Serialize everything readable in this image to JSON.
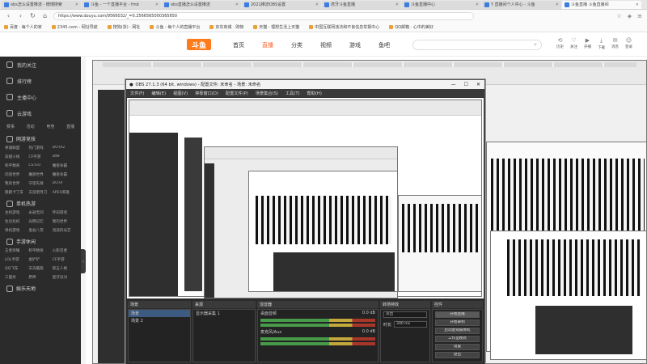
{
  "tabs": [
    {
      "label": "obs怎么设置推流 - 微博搜索",
      "active": false
    },
    {
      "label": "斗鱼 - 一个直播平台 - fmb",
      "active": false
    },
    {
      "label": "obs直播怎么设置推流",
      "active": false
    },
    {
      "label": "2021推流OBS设置",
      "active": false
    },
    {
      "label": "虎牙斗鱼直播",
      "active": false
    },
    {
      "label": "斗鱼直播中心",
      "active": false
    },
    {
      "label": "Y 直播间个人中心 - 斗鱼",
      "active": false
    },
    {
      "label": "斗鱼直播 斗鱼直播间",
      "active": true
    }
  ],
  "url": "https://www.douyu.com/9566032/_=0.2566565000365650",
  "bookmarks": [
    "百度 · 每个人的家",
    "2345.com - 网址导航",
    "搜狗(浙) · 网址",
    "斗鱼 - 每个人的直播平台",
    "京东商城 · 购物",
    "天猫 - 理想生活上天猫",
    "中国互联网违法和不良信息举报中心",
    "QQ邮箱 · 心中的美好"
  ],
  "header": {
    "logo": "斗鱼",
    "nav": [
      "首页",
      "直播",
      "分类",
      "视频",
      "游戏",
      "鱼吧"
    ],
    "active_nav": "直播",
    "search_icon": "search-icon",
    "user_tools": [
      "历史",
      "关注",
      "开播",
      "下载",
      "消息",
      "登录"
    ]
  },
  "sidebar": {
    "top": [
      "我的关注",
      "排行榜",
      "主播中心",
      "云游戏"
    ],
    "icons_row": [
      "赛事",
      "活动",
      "电竞",
      "直播"
    ],
    "sections": [
      {
        "title": "网游竞技",
        "items": [
          "英雄联盟",
          "热门游戏",
          "DOTA2",
          "穿越火线",
          "CF手游",
          "DNF",
          "和平精英",
          "CS:GO",
          "魔兽争霸",
          "问道世界",
          "魔兽世界",
          "魔兽争霸",
          "我的世界",
          "守望先锋",
          "DOTA",
          "跑跑卡丁车",
          "天涯明月刀",
          "APEX英雄"
        ]
      },
      {
        "title": "单机热游",
        "items": [
          "主机游戏",
          "永劫无间",
          "怀旧游戏",
          "生化危机",
          "光明记忆",
          "我的世界",
          "单机游戏",
          "鬼谷八荒",
          "消逝的光芒"
        ]
      },
      {
        "title": "手游休闲",
        "items": [
          "王者荣耀",
          "和平精英",
          "火影忍者",
          "LOL手游",
          "金铲铲",
          "CF手游",
          "QQ飞车",
          "天天酷跑",
          "第五人格",
          "三国杀",
          "原神",
          "蛋仔派对"
        ]
      },
      {
        "title": "娱乐天地",
        "items": []
      }
    ]
  },
  "obs": {
    "title": "OBS 27.1.3 (64 bit, windows) - 配置文件: 未命名 - 场景: 未命名",
    "menu": [
      "文件(F)",
      "编辑(E)",
      "视图(V)",
      "停靠窗口(D)",
      "配置文件(P)",
      "场景集合(S)",
      "工具(T)",
      "帮助(H)"
    ],
    "scenes_label": "场景",
    "sources_label": "来源",
    "mixer_label": "混音器",
    "transitions_label": "转场特效",
    "controls_label": "控件",
    "scenes": [
      "场景",
      "场景 2"
    ],
    "sources": [
      "显示器采集 1"
    ],
    "mixer": [
      {
        "name": "桌面音频",
        "db": "0.0 dB"
      },
      {
        "name": "麦克风/Aux",
        "db": "0.0 dB"
      }
    ],
    "transition": {
      "type": "淡出",
      "duration_label": "时长",
      "duration": "300 ms"
    },
    "controls": [
      "开始直播",
      "开始录制",
      "启动虚拟摄像机",
      "工作室模式",
      "设置",
      "退出"
    ],
    "filter_hint": "未选择源"
  },
  "colors": {
    "accent": "#ff5d23",
    "sidebar_bg": "#2b2b2b",
    "obs_bg": "#2e2e2e"
  }
}
